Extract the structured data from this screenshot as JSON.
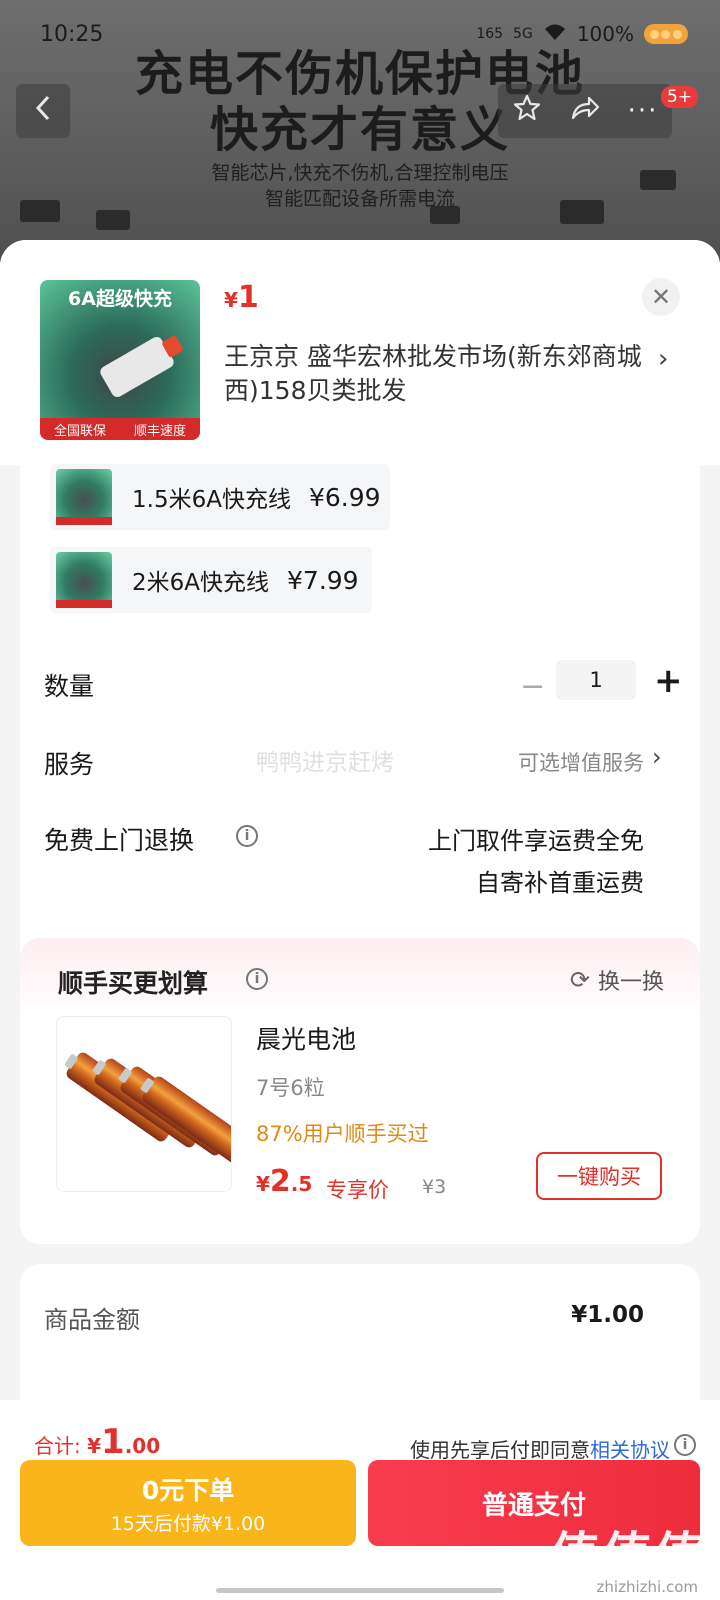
{
  "status_bar": {
    "time": "10:25",
    "net": "165",
    "signal": "5G",
    "battery": "100%"
  },
  "banner": {
    "headline1": "充电不伤机保护电池",
    "headline2": "快充才有意义",
    "sub1": "智能芯片,快充不伤机,合理控制电压",
    "sub2": "智能匹配设备所需电流"
  },
  "nav": {
    "back_icon": "back-arrow-icon",
    "favorite_icon": "star-icon",
    "share_icon": "share-icon",
    "more_icon": "more-icon",
    "badge": "5+"
  },
  "product": {
    "thumb_title": "6A超级快充",
    "thumb_tag1": "全国联保",
    "thumb_tag2": "顺丰速度",
    "price_symbol": "¥",
    "price": "1",
    "shop": "王京京  盛华宏林批发市场(新东郊商城西)158贝类批发"
  },
  "variants": [
    {
      "label": "1.5米6A快充线",
      "price": "¥6.99"
    },
    {
      "label": "2米6A快充线",
      "price": "¥7.99"
    }
  ],
  "quantity": {
    "label": "数量",
    "value": "1",
    "minus": "−",
    "plus": "+"
  },
  "service": {
    "label": "服务",
    "value": "可选增值服务",
    "watermark": "鸭鸭进京赶烤"
  },
  "returns": {
    "label": "免费上门退换",
    "line1": "上门取件享运费全免",
    "line2": "自寄补首重运费"
  },
  "bundle": {
    "title": "顺手买更划算",
    "swap": "换一换",
    "name": "晨光电池",
    "spec": "7号6粒",
    "bought": "87%用户顺手买过",
    "price_symbol": "¥",
    "price_int": "2",
    "price_dec": ".5",
    "exclusive": "专享价",
    "original": "¥3",
    "buy_button": "一键购买"
  },
  "amount": {
    "label": "商品金额",
    "value": "¥1.00"
  },
  "footer": {
    "total_label": "合计: ",
    "total_symbol": "¥",
    "total_int": "1",
    "total_dec": ".00",
    "agree_text": "使用先享后付即同意",
    "agree_link": "相关协议",
    "later_line1": "0元下单",
    "later_line2": "15天后付款¥1.00",
    "pay_button": "普通支付",
    "wm_site": "值值值",
    "wm_url": "zhizhizhi.com"
  },
  "colors": {
    "accent_red": "#e3312a",
    "later_yellow": "#f9b51a",
    "pay_red": "#f83c4f",
    "link_blue": "#2c6ad8",
    "orange_text": "#e08a16"
  }
}
